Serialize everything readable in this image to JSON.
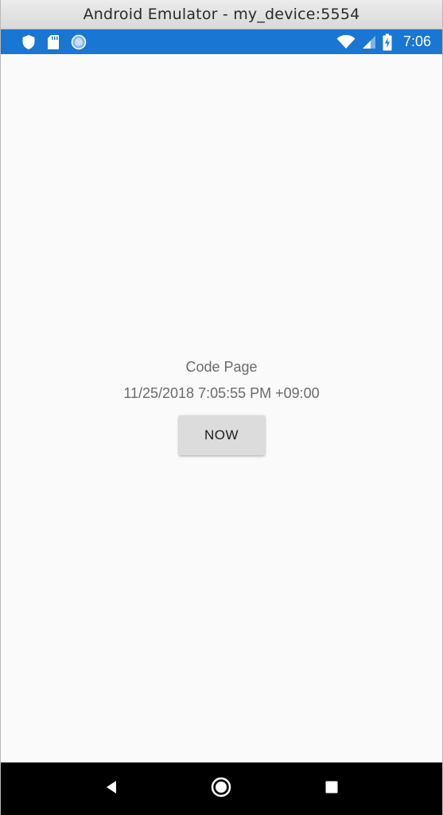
{
  "window": {
    "title": "Android Emulator - my_device:5554"
  },
  "status_bar": {
    "left_icons": [
      "shield-icon",
      "sd-card-icon",
      "sync-circle-icon"
    ],
    "right_icons": [
      "wifi-icon",
      "cell-signal-icon",
      "battery-charging-icon"
    ],
    "time": "7:06",
    "color": "#1976d2"
  },
  "page": {
    "title": "Code Page",
    "datetime": "11/25/2018 7:05:55 PM +09:00",
    "now_button_label": "NOW"
  },
  "nav_bar": {
    "buttons": [
      "back-icon",
      "home-icon",
      "recents-icon"
    ]
  }
}
